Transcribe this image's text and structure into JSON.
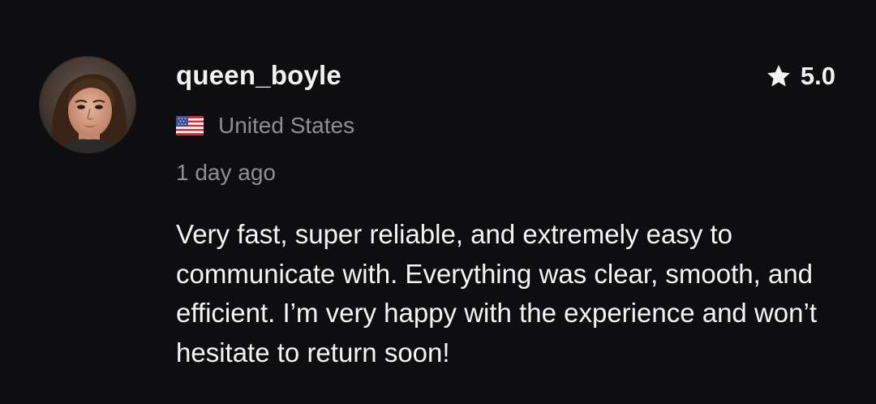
{
  "review": {
    "username": "queen_boyle",
    "rating": "5.0",
    "country": "United States",
    "time_ago": "1 day ago",
    "text": "Very fast, super reliable, and extremely easy to communicate with. Everything was clear, smooth, and efficient. I’m very happy with the experience and won’t hesitate to return soon!"
  },
  "icons": {
    "star": "star-icon",
    "flag": "us-flag-icon",
    "avatar": "avatar"
  },
  "colors": {
    "background": "#0e0e10",
    "primary_text": "#f2f2f2",
    "secondary_text": "#8e8e93"
  }
}
